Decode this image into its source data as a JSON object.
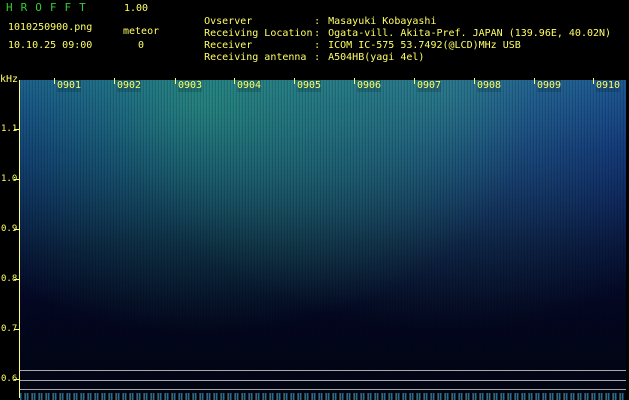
{
  "header": {
    "app_title": "HROFFT",
    "version": "1.00",
    "filename": "1010250900.png",
    "timestamp": "10.10.25 09:00",
    "meteor_label": "meteor",
    "meteor_count": "0"
  },
  "info": [
    {
      "label": "Ovserver",
      "value": "Masayuki Kobayashi"
    },
    {
      "label": "Receiving Location",
      "value": "Ogata-vill. Akita-Pref. JAPAN (139.96E, 40.02N)"
    },
    {
      "label": "Receiver",
      "value": "ICOM IC-575 53.7492(@LCD)MHz USB"
    },
    {
      "label": "Receiving antenna",
      "value": "A504HB(yagi 4el)"
    }
  ],
  "spectrogram": {
    "y_unit": "kHz",
    "y_ticks": [
      "1.1",
      "1.0",
      "0.9",
      "0.8",
      "0.7",
      "0.6"
    ],
    "x_ticks": [
      "0901",
      "0902",
      "0903",
      "0904",
      "0905",
      "0906",
      "0907",
      "0908",
      "0909",
      "0910"
    ],
    "colors": {
      "text": "#ffff66",
      "title": "#33cc33",
      "signal_high": "#3ce08c",
      "signal_mid": "#1a58b8",
      "background": "#000000"
    }
  }
}
